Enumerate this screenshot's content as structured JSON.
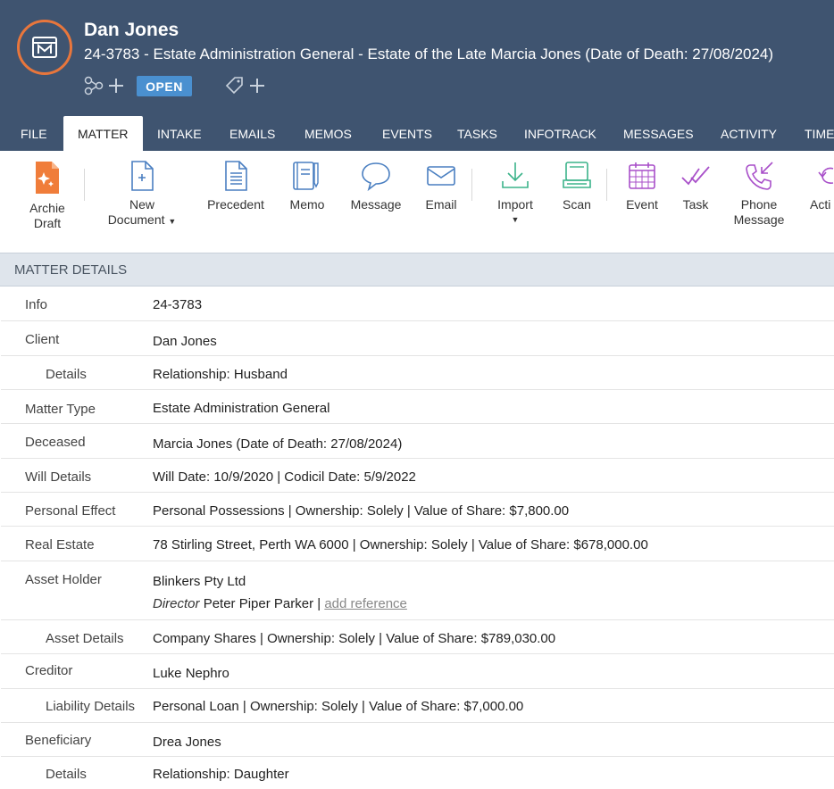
{
  "header": {
    "client_name": "Dan Jones",
    "matter_title": "24-3783 - Estate Administration General - Estate of the Late Marcia Jones (Date of Death: 27/08/2024)",
    "status": "OPEN"
  },
  "tabs": [
    {
      "label": "FILE"
    },
    {
      "label": "MATTER"
    },
    {
      "label": "INTAKE"
    },
    {
      "label": "EMAILS"
    },
    {
      "label": "MEMOS"
    },
    {
      "label": "EVENTS"
    },
    {
      "label": "TASKS"
    },
    {
      "label": "INFOTRACK"
    },
    {
      "label": "MESSAGES"
    },
    {
      "label": "ACTIVITY"
    },
    {
      "label": "TIME"
    }
  ],
  "toolbar": {
    "archie_line1": "Archie",
    "archie_line2": "Draft",
    "new_doc_line1": "New",
    "new_doc_line2": "Document",
    "precedent": "Precedent",
    "memo": "Memo",
    "message": "Message",
    "email": "Email",
    "import": "Import",
    "scan": "Scan",
    "event": "Event",
    "task": "Task",
    "phone_line1": "Phone",
    "phone_line2": "Message",
    "activity": "Acti"
  },
  "section": {
    "title": "MATTER DETAILS"
  },
  "details": {
    "info_label": "Info",
    "info_value": "24-3783",
    "client_label": "Client",
    "client_value": "Dan Jones",
    "client_details_label": "Details",
    "client_details_value": "Relationship: Husband",
    "matter_type_label": "Matter Type",
    "matter_type_value": "Estate Administration General",
    "deceased_label": "Deceased",
    "deceased_value": "Marcia Jones (Date of Death: 27/08/2024)",
    "will_label": "Will Details",
    "will_value": "Will Date: 10/9/2020 | Codicil Date: 5/9/2022",
    "personal_label": "Personal Effect",
    "personal_value": "Personal Possessions | Ownership: Solely | Value of Share: $7,800.00",
    "real_estate_label": "Real Estate",
    "real_estate_value": "78 Stirling Street, Perth WA 6000 | Ownership: Solely | Value of Share: $678,000.00",
    "asset_holder_label": "Asset Holder",
    "asset_holder_value": "Blinkers Pty Ltd",
    "director_role": "Director",
    "director_name": "Peter Piper Parker",
    "director_sep": "|",
    "add_reference": "add reference",
    "asset_details_label": "Asset Details",
    "asset_details_value": "Company Shares | Ownership: Solely | Value of Share: $789,030.00",
    "creditor_label": "Creditor",
    "creditor_value": "Luke Nephro",
    "liability_label": "Liability Details",
    "liability_value": "Personal Loan | Ownership: Solely | Value of Share: $7,000.00",
    "beneficiary_label": "Beneficiary",
    "beneficiary_value": "Drea Jones",
    "beneficiary_details_label": "Details",
    "beneficiary_details_value": "Relationship: Daughter"
  },
  "colors": {
    "header_bg": "#3f5470",
    "accent_orange": "#e8763c",
    "status_blue": "#4a90d0",
    "icon_blue": "#4a7fc1",
    "icon_green": "#3bb38a",
    "icon_purple": "#a84fc9"
  }
}
